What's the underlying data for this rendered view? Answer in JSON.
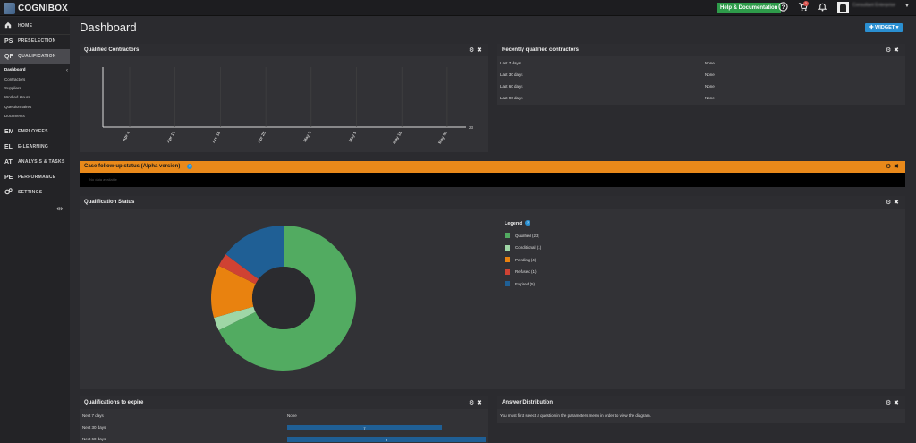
{
  "app": {
    "logo_text": "COGNIBOX"
  },
  "topbar": {
    "help_label": "Help & Documentation",
    "help_icon": "question-circle-icon",
    "cart_icon": "cart-icon",
    "cart_badge": "1",
    "bell_icon": "bell-icon",
    "user_name": "Consultant Enterprise"
  },
  "sidebar": {
    "items": [
      {
        "code": "",
        "label": "HOME",
        "icon": "home-icon"
      },
      {
        "code": "PS",
        "label": "PRESELECTION"
      },
      {
        "code": "QF",
        "label": "QUALIFICATION"
      },
      {
        "code": "EM",
        "label": "EMPLOYEES"
      },
      {
        "code": "EL",
        "label": "E-LEARNING"
      },
      {
        "code": "AT",
        "label": "ANALYSIS & TASKS"
      },
      {
        "code": "PE",
        "label": "PERFORMANCE"
      },
      {
        "code": "",
        "label": "SETTINGS",
        "icon": "gears-icon"
      }
    ],
    "sub_items": [
      "Dashboard",
      "Contractors",
      "Suppliers",
      "Worked Hours",
      "Questionnaires",
      "Documents"
    ]
  },
  "page": {
    "title": "Dashboard",
    "widget_button": "✚ WIDGET ▾"
  },
  "qualified_contractors": {
    "title": "Qualified Contractors",
    "y_end_label": "23",
    "chart_data": {
      "type": "line",
      "categories": [
        "Apr 4",
        "Apr 11",
        "Apr 18",
        "Apr 25",
        "May 2",
        "May 9",
        "May 16",
        "May 23"
      ],
      "series": [],
      "ylabel_right": "23"
    }
  },
  "recent": {
    "title": "Recently qualified contractors",
    "rows": [
      {
        "label": "Last 7 days",
        "value": "None"
      },
      {
        "label": "Last 30 days",
        "value": "None"
      },
      {
        "label": "Last 60 days",
        "value": "None"
      },
      {
        "label": "Last 90 days",
        "value": "None"
      }
    ]
  },
  "case_followup": {
    "title": "Case follow-up status (Alpha version)",
    "body": "No data available"
  },
  "qualification_status": {
    "title": "Qualification Status",
    "legend_title": "Legend",
    "chart_data": {
      "type": "pie",
      "categories": [
        "Qualified (23)",
        "Conditional (1)",
        "Pending (4)",
        "Refused (1)",
        "Expired (5)"
      ],
      "values": [
        23,
        1,
        4,
        1,
        5
      ],
      "colors": [
        "#52ab61",
        "#9fd6a6",
        "#e9820f",
        "#cf4233",
        "#1f5f95"
      ]
    }
  },
  "to_expire": {
    "title": "Qualifications to expire",
    "rows": [
      {
        "label": "Next 7 days",
        "value": "None"
      },
      {
        "label": "Next 30 days",
        "value": "7"
      },
      {
        "label": "Next 60 days",
        "value": "9"
      }
    ]
  },
  "answer_distribution": {
    "title": "Answer Distribution",
    "message": "You must first select a question in the parameters menu in order to view the diagram."
  },
  "controls": {
    "gear": "⚙",
    "close": "✖"
  }
}
